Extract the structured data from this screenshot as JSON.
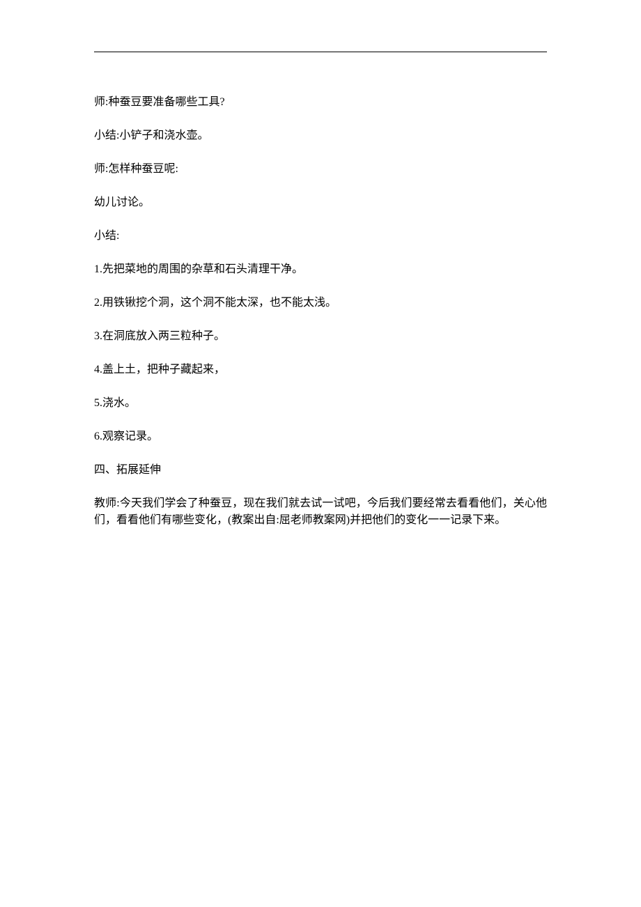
{
  "lines": [
    "师:种蚕豆要准备哪些工具?",
    "小结:小铲子和浇水壶。",
    "师:怎样种蚕豆呢:",
    "幼儿讨论。",
    "小结:",
    "1.先把菜地的周围的杂草和石头清理干净。",
    "2.用铁锹挖个洞，这个洞不能太深，也不能太浅。",
    "3.在洞底放入两三粒种子。",
    "4.盖上土，把种子藏起来，",
    "5.浇水。",
    "6.观察记录。",
    "四、拓展延伸",
    "教师:今天我们学会了种蚕豆，现在我们就去试一试吧，今后我们要经常去看看他们，关心他们，看看他们有哪些变化，(教案出自:屈老师教案网)并把他们的变化一一记录下来。"
  ]
}
